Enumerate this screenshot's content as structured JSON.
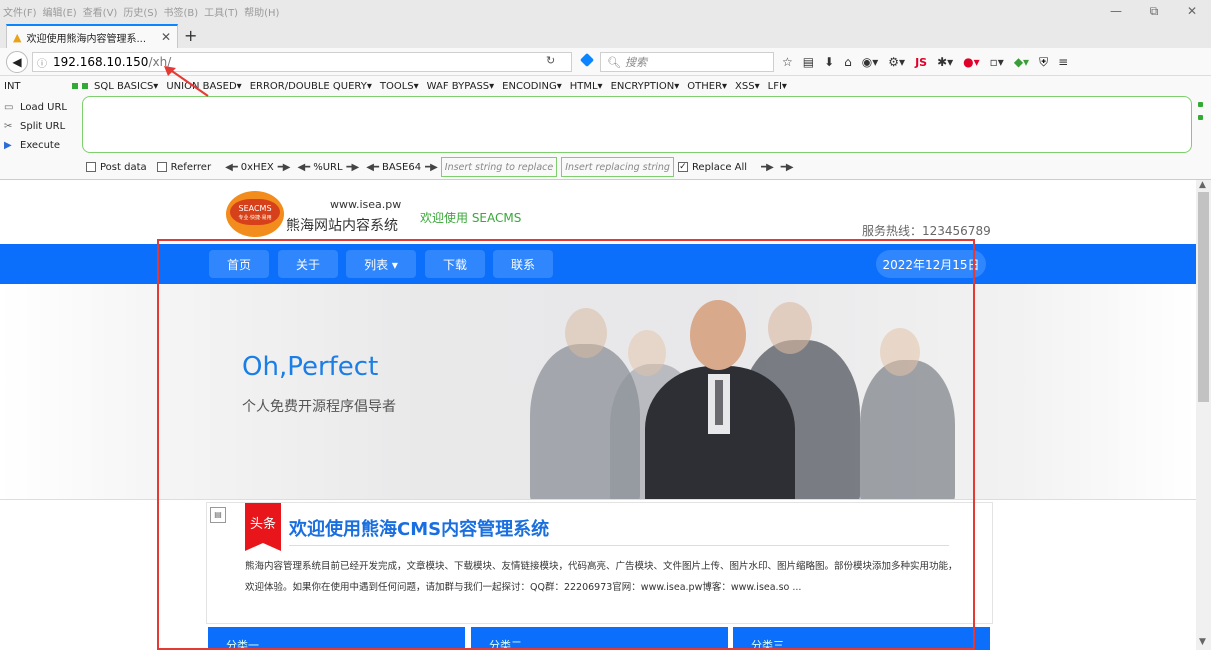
{
  "menubar": [
    "文件(F)",
    "编辑(E)",
    "查看(V)",
    "历史(S)",
    "书签(B)",
    "工具(T)",
    "帮助(H)"
  ],
  "window_controls": {
    "minimize": "—",
    "restore": "⧉",
    "close": "✕"
  },
  "tab": {
    "title": "欢迎使用熊海内容管理系...",
    "close": "✕",
    "new": "+"
  },
  "address": {
    "host": "192.168.10.150",
    "path": "/xh/"
  },
  "search": {
    "placeholder": "搜索"
  },
  "toolbar": {
    "js": "JS"
  },
  "hackbar": {
    "select": "INT",
    "menus": [
      "SQL BASICS▾",
      "UNION BASED▾",
      "ERROR/DOUBLE QUERY▾",
      "TOOLS▾",
      "WAF BYPASS▾",
      "ENCODING▾",
      "HTML▾",
      "ENCRYPTION▾",
      "OTHER▾",
      "XSS▾",
      "LFI▾"
    ],
    "actions": [
      "Load URL",
      "Split URL",
      "Execute"
    ],
    "post_data": "Post data",
    "referrer": "Referrer",
    "hex": "0xHEX",
    "url": "%URL",
    "base64": "BASE64",
    "replace_placeholder": "Insert string to replace",
    "replacing_placeholder": "Insert replacing string",
    "replace_all": "Replace All"
  },
  "site": {
    "logo_text": "SEACMS",
    "logo_sub": "专业·快捷·易用",
    "url": "www.isea.pw",
    "name": "熊海网站内容系统",
    "welcome": "欢迎使用 SEACMS",
    "hotline": "服务热线：123456789",
    "nav": [
      "首页",
      "关于",
      "列表 ▾",
      "下载",
      "联系"
    ],
    "date": "2022年12月15日",
    "banner_title": "Oh,Perfect",
    "banner_sub": "个人免费开源程序倡导者",
    "news_badge": "头条",
    "news_title": "欢迎使用熊海CMS内容管理系统",
    "news_body": "熊海内容管理系统目前已经开发完成，文章模块、下载模块、友情链接模块，代码高亮、广告模块、文件图片上传、图片水印、图片缩略图。部份模块添加多种实用功能，欢迎体验。如果你在使用中遇到任何问题，请加群与我们一起探讨：QQ群：22206973官网：www.isea.pw博客：www.isea.so ...",
    "categories": [
      "分类一",
      "分类二",
      "分类三"
    ]
  }
}
